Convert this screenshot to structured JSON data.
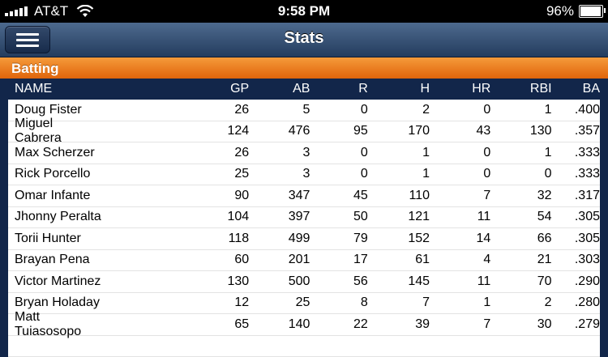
{
  "status_bar": {
    "carrier": "AT&T",
    "time": "9:58 PM",
    "battery": "96%",
    "battery_level": 0.96
  },
  "navbar": {
    "title": "Stats"
  },
  "section": {
    "title": "Batting"
  },
  "table": {
    "headers": {
      "name": "NAME",
      "gp": "GP",
      "ab": "AB",
      "r": "R",
      "h": "H",
      "hr": "HR",
      "rbi": "RBI",
      "ba": "BA"
    },
    "rows": [
      {
        "name": "Doug Fister",
        "gp": "26",
        "ab": "5",
        "r": "0",
        "h": "2",
        "hr": "0",
        "rbi": "1",
        "ba": ".400"
      },
      {
        "name": "Miguel Cabrera",
        "gp": "124",
        "ab": "476",
        "r": "95",
        "h": "170",
        "hr": "43",
        "rbi": "130",
        "ba": ".357"
      },
      {
        "name": "Max Scherzer",
        "gp": "26",
        "ab": "3",
        "r": "0",
        "h": "1",
        "hr": "0",
        "rbi": "1",
        "ba": ".333"
      },
      {
        "name": "Rick Porcello",
        "gp": "25",
        "ab": "3",
        "r": "0",
        "h": "1",
        "hr": "0",
        "rbi": "0",
        "ba": ".333"
      },
      {
        "name": "Omar Infante",
        "gp": "90",
        "ab": "347",
        "r": "45",
        "h": "110",
        "hr": "7",
        "rbi": "32",
        "ba": ".317"
      },
      {
        "name": "Jhonny Peralta",
        "gp": "104",
        "ab": "397",
        "r": "50",
        "h": "121",
        "hr": "11",
        "rbi": "54",
        "ba": ".305"
      },
      {
        "name": "Torii Hunter",
        "gp": "118",
        "ab": "499",
        "r": "79",
        "h": "152",
        "hr": "14",
        "rbi": "66",
        "ba": ".305"
      },
      {
        "name": "Brayan Pena",
        "gp": "60",
        "ab": "201",
        "r": "17",
        "h": "61",
        "hr": "4",
        "rbi": "21",
        "ba": ".303"
      },
      {
        "name": "Victor Martinez",
        "gp": "130",
        "ab": "500",
        "r": "56",
        "h": "145",
        "hr": "11",
        "rbi": "70",
        "ba": ".290"
      },
      {
        "name": "Bryan Holaday",
        "gp": "12",
        "ab": "25",
        "r": "8",
        "h": "7",
        "hr": "1",
        "rbi": "2",
        "ba": ".280"
      },
      {
        "name": "Matt Tuiasosopo",
        "gp": "65",
        "ab": "140",
        "r": "22",
        "h": "39",
        "hr": "7",
        "rbi": "30",
        "ba": ".279"
      },
      {
        "name": "",
        "gp": "",
        "ab": "",
        "r": "",
        "h": "",
        "hr": "",
        "rbi": "",
        "ba": ""
      }
    ]
  }
}
